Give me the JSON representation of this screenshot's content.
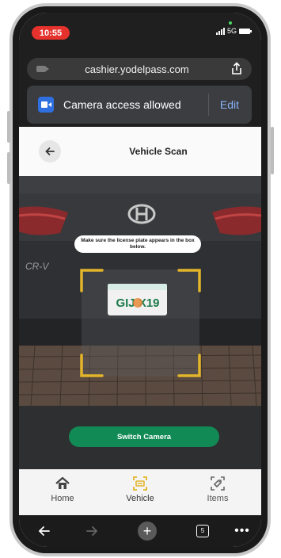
{
  "status_bar": {
    "time": "10:55",
    "network": "5G"
  },
  "browser": {
    "url": "cashier.yodelpass.com",
    "permission_text": "Camera access allowed",
    "permission_action": "Edit"
  },
  "header": {
    "title": "Vehicle Scan"
  },
  "camera": {
    "instruction": "Make sure the license plate appears in the box below.",
    "plate_text": "GIJ X19",
    "switch_label": "Switch Camera"
  },
  "tabs": [
    {
      "label": "Home",
      "icon": "home-icon"
    },
    {
      "label": "Vehicle",
      "icon": "scan-icon",
      "active": true
    },
    {
      "label": "Items",
      "icon": "tag-scan-icon"
    }
  ],
  "bottom_nav": {
    "tab_count": "5"
  },
  "colors": {
    "accent_gold": "#e3b52a",
    "primary_green": "#118a55",
    "text_dark": "#222222"
  }
}
